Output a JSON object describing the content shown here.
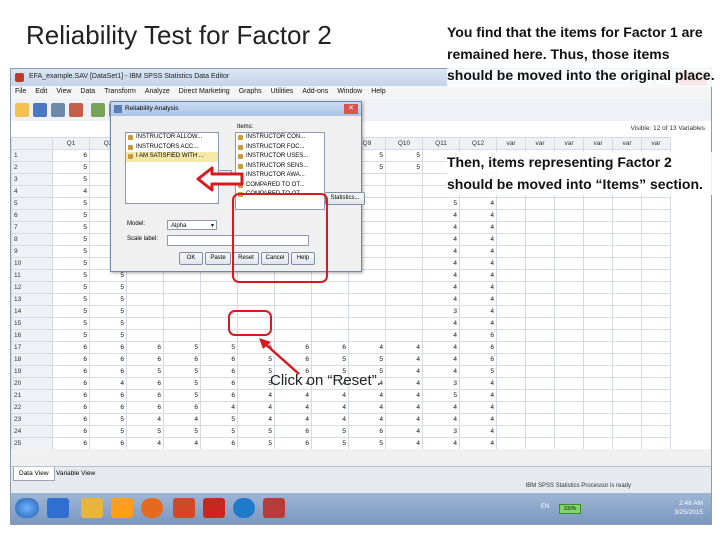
{
  "slide": {
    "title": "Reliability Test for Factor 2",
    "instruction_1": "You find that the items for Factor 1 are remained here. Thus, those items should be moved into the original place.",
    "instruction_2": "Then, items representing Factor 2 should be moved into “Items” section.",
    "click_note": "Click on “Reset”."
  },
  "window": {
    "title": "EFA_example.SAV [DataSet1] - IBM SPSS Statistics Data Editor",
    "menu": [
      "File",
      "Edit",
      "View",
      "Data",
      "Transform",
      "Analyze",
      "Direct Marketing",
      "Graphs",
      "Utilities",
      "Add-ons",
      "Window",
      "Help"
    ],
    "visible_label": "Visible: 12 of 13 Variables",
    "status": "IBM SPSS Statistics Processor is ready"
  },
  "grid": {
    "columns": [
      "Q1",
      "Q2",
      "Q3",
      "Q4",
      "Q5",
      "Q6",
      "Q7",
      "Q8",
      "Q9",
      "Q10",
      "Q11",
      "Q12",
      "var",
      "var",
      "var",
      "var",
      "var",
      "var"
    ],
    "rows": [
      [
        "1",
        "6",
        "5",
        "5",
        "5",
        "6",
        "5",
        "5",
        "3",
        "5",
        "5",
        "4",
        "3"
      ],
      [
        "2",
        "5",
        "5",
        "5",
        "5",
        "5",
        "5",
        "5",
        "5",
        "5",
        "5",
        "4",
        "4"
      ],
      [
        "3",
        "5",
        "4",
        "",
        "",
        "",
        "",
        "",
        "",
        "",
        "",
        "4",
        "4"
      ],
      [
        "4",
        "4",
        "4",
        "",
        "",
        "",
        "",
        "",
        "",
        "",
        "",
        "4",
        "4"
      ],
      [
        "5",
        "5",
        "5",
        "",
        "",
        "",
        "",
        "",
        "",
        "",
        "",
        "5",
        "4"
      ],
      [
        "6",
        "5",
        "5",
        "",
        "",
        "",
        "",
        "",
        "",
        "",
        "",
        "4",
        "4"
      ],
      [
        "7",
        "5",
        "5",
        "",
        "",
        "",
        "",
        "",
        "",
        "",
        "",
        "4",
        "4"
      ],
      [
        "8",
        "5",
        "4",
        "",
        "",
        "",
        "",
        "",
        "",
        "",
        "",
        "4",
        "4"
      ],
      [
        "9",
        "5",
        "5",
        "",
        "",
        "",
        "",
        "",
        "",
        "",
        "",
        "4",
        "4"
      ],
      [
        "10",
        "5",
        "4",
        "",
        "",
        "",
        "",
        "",
        "",
        "",
        "",
        "4",
        "4"
      ],
      [
        "11",
        "5",
        "5",
        "",
        "",
        "",
        "",
        "",
        "",
        "",
        "",
        "4",
        "4"
      ],
      [
        "12",
        "5",
        "5",
        "",
        "",
        "",
        "",
        "",
        "",
        "",
        "",
        "4",
        "4"
      ],
      [
        "13",
        "5",
        "5",
        "",
        "",
        "",
        "",
        "",
        "",
        "",
        "",
        "4",
        "4"
      ],
      [
        "14",
        "5",
        "5",
        "",
        "",
        "",
        "",
        "",
        "",
        "",
        "",
        "3",
        "4"
      ],
      [
        "15",
        "5",
        "5",
        "",
        "",
        "",
        "",
        "",
        "",
        "",
        "",
        "4",
        "4"
      ],
      [
        "16",
        "5",
        "5",
        "",
        "",
        "",
        "",
        "",
        "",
        "",
        "",
        "4",
        "6"
      ],
      [
        "17",
        "6",
        "6",
        "6",
        "5",
        "5",
        "6",
        "6",
        "6",
        "4",
        "4",
        "4",
        "6"
      ],
      [
        "18",
        "6",
        "6",
        "6",
        "6",
        "6",
        "5",
        "6",
        "5",
        "5",
        "4",
        "4",
        "6"
      ],
      [
        "19",
        "6",
        "6",
        "5",
        "5",
        "6",
        "5",
        "6",
        "5",
        "5",
        "4",
        "4",
        "5"
      ],
      [
        "20",
        "6",
        "4",
        "6",
        "5",
        "6",
        "5",
        "4",
        "4",
        "4",
        "4",
        "3",
        "4"
      ],
      [
        "21",
        "6",
        "6",
        "6",
        "5",
        "6",
        "4",
        "4",
        "4",
        "4",
        "4",
        "5",
        "4"
      ],
      [
        "22",
        "6",
        "6",
        "6",
        "6",
        "4",
        "4",
        "4",
        "4",
        "4",
        "4",
        "4",
        "4"
      ],
      [
        "23",
        "6",
        "5",
        "4",
        "4",
        "5",
        "4",
        "4",
        "4",
        "4",
        "4",
        "4",
        "4"
      ],
      [
        "24",
        "6",
        "5",
        "5",
        "5",
        "5",
        "5",
        "6",
        "5",
        "6",
        "4",
        "3",
        "4"
      ],
      [
        "25",
        "6",
        "6",
        "4",
        "4",
        "6",
        "5",
        "6",
        "5",
        "5",
        "4",
        "4",
        "4"
      ]
    ]
  },
  "tabs": {
    "data_view": "Data View",
    "variable_view": "Variable View"
  },
  "taskbar": {
    "zoom": "100%",
    "lang": "EN",
    "time": "2:48 AM",
    "date": "3/25/2015"
  },
  "dialog": {
    "title": "Reliability Analysis",
    "left_items": [
      "INSTRUCTOR ALLOW...",
      "INSTRUCTORS ACC...",
      "I AM SATISFIED WITH ..."
    ],
    "items_label": "Items:",
    "right_items": [
      "INSTRUCTOR CON...",
      "INSTRUCTOR FOC...",
      "INSTRUCTOR USES...",
      "INSTRUCTOR SENS...",
      "INSTRUCTOR AWA...",
      "COMPARED TO OT...",
      "COMPARED TO OT..."
    ],
    "statistics": "Statistics...",
    "model_label": "Model:",
    "model_value": "Alpha",
    "scale_label": "Scale label:",
    "buttons": {
      "ok": "OK",
      "paste": "Paste",
      "reset": "Reset",
      "cancel": "Cancel",
      "help": "Help"
    }
  },
  "colors": {
    "highlight": "#d71920",
    "dialog_title": "#a9c3e6"
  },
  "icons": [
    "windows-start-icon",
    "explorer-icon",
    "media-icon",
    "firefox-icon",
    "powerpoint-icon",
    "pdf-icon",
    "browser-icon",
    "spss-icon"
  ]
}
